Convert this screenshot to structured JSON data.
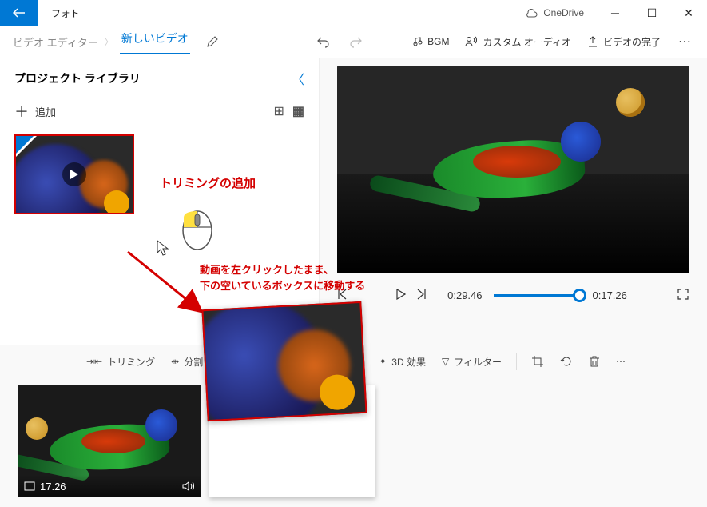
{
  "titlebar": {
    "app": "フォト",
    "onedrive": "OneDrive"
  },
  "toolbar": {
    "breadcrumb_prev": "ビデオ エディター",
    "new_video": "新しいビデオ",
    "bgm": "BGM",
    "custom_audio": "カスタム オーディオ",
    "finish": "ビデオの完了"
  },
  "library": {
    "title": "プロジェクト ライブラリ",
    "add": "追加"
  },
  "preview": {
    "time_current": "0:29.46",
    "time_total": "0:17.26"
  },
  "lowbar": {
    "trim": "トリミング",
    "split": "分割",
    "three_d": "3D 効果",
    "filter": "フィルター"
  },
  "storyboard": {
    "clip_duration": "17.26"
  },
  "annotations": {
    "add_trim": "トリミングの追加",
    "drag_hint_line1": "動画を左クリックしたまま、",
    "drag_hint_line2": "下の空いているボックスに移動する"
  }
}
